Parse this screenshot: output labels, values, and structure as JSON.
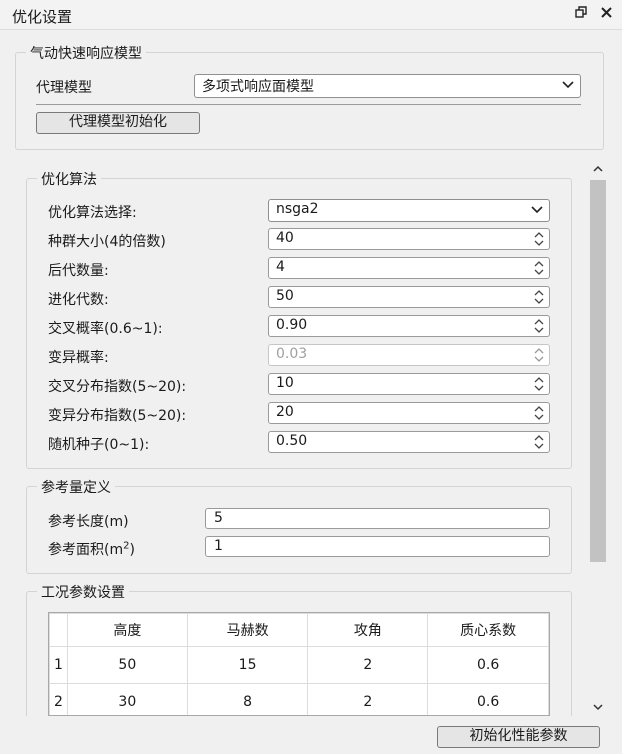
{
  "window": {
    "title": "优化设置",
    "restore_icon": "restore-icon",
    "close_icon": "close-icon"
  },
  "aero_model": {
    "title": "气动快速响应模型",
    "proxy_label": "代理模型",
    "proxy_value": "多项式响应面模型",
    "init_button": "代理模型初始化"
  },
  "algorithm": {
    "title": "优化算法",
    "select_label": "优化算法选择:",
    "select_value": "nsga2",
    "params": [
      {
        "label": "种群大小(4的倍数)",
        "value": "40",
        "disabled": false
      },
      {
        "label": "后代数量:",
        "value": "4",
        "disabled": false
      },
      {
        "label": "进化代数:",
        "value": "50",
        "disabled": false
      },
      {
        "label": "交叉概率(0.6~1):",
        "value": "0.90",
        "disabled": false
      },
      {
        "label": "变异概率:",
        "value": "0.03",
        "disabled": true
      },
      {
        "label": "交叉分布指数(5~20):",
        "value": "10",
        "disabled": false
      },
      {
        "label": "变异分布指数(5~20):",
        "value": "20",
        "disabled": false
      },
      {
        "label": "随机种子(0~1):",
        "value": "0.50",
        "disabled": false
      }
    ]
  },
  "reference": {
    "title": "参考量定义",
    "length_label": "参考长度(m)",
    "length_value": "5",
    "area_label": "参考面积(m",
    "area_sup": "2",
    "area_close": ")",
    "area_value": "1"
  },
  "conditions": {
    "title": "工况参数设置",
    "columns": [
      "高度",
      "马赫数",
      "攻角",
      "质心系数"
    ],
    "rows": [
      {
        "index": "1",
        "cells": [
          "50",
          "15",
          "2",
          "0.6"
        ]
      },
      {
        "index": "2",
        "cells": [
          "30",
          "8",
          "2",
          "0.6"
        ]
      }
    ]
  },
  "footer": {
    "init_perf_button": "初始化性能参数"
  }
}
